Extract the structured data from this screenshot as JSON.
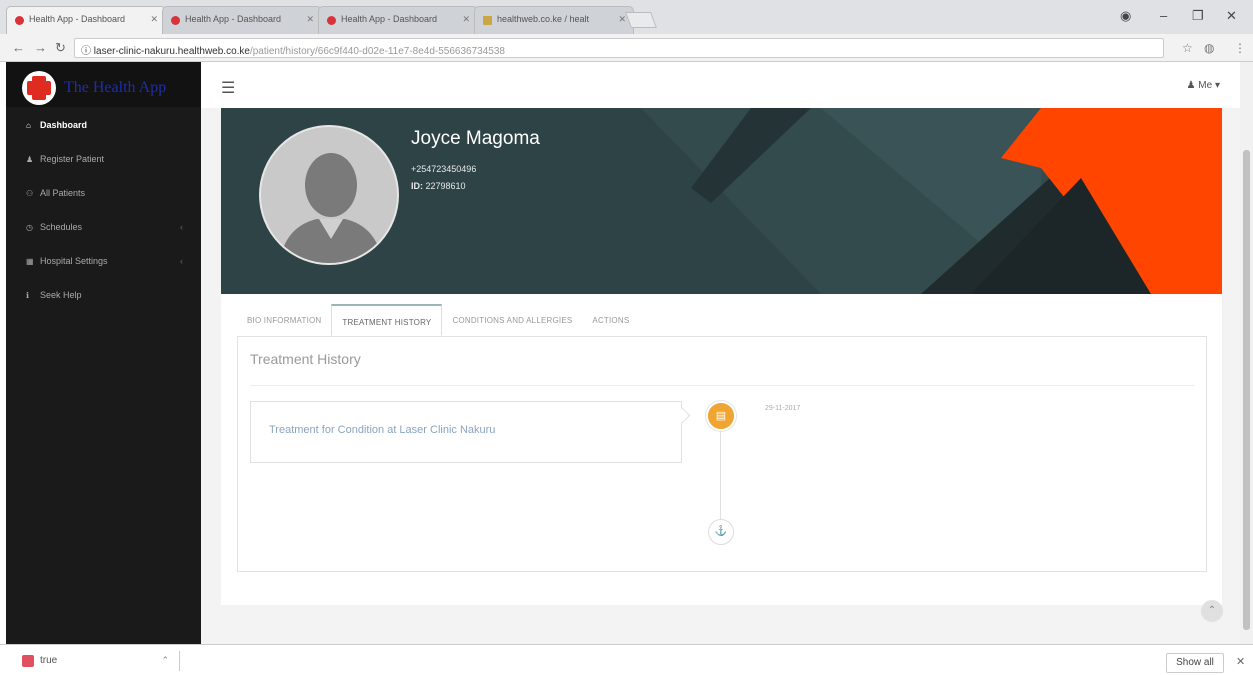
{
  "browser": {
    "tabs": [
      {
        "label": "Health App - Dashboard",
        "active": true
      },
      {
        "label": "Health App - Dashboard",
        "active": false
      },
      {
        "label": "Health App - Dashboard",
        "active": false
      },
      {
        "label": "healthweb.co.ke / healt",
        "active": false
      }
    ],
    "url_host": "laser-clinic-nakuru.healthweb.co.ke",
    "url_path": "/patient/history/66c9f440-d02e-11e7-8e4d-556636734538"
  },
  "sidebar": {
    "brand": "The Health App",
    "items": [
      {
        "label": "Dashboard",
        "icon": "home-icon",
        "active": true
      },
      {
        "label": "Register Patient",
        "icon": "user-icon"
      },
      {
        "label": "All Patients",
        "icon": "users-icon"
      },
      {
        "label": "Schedules",
        "icon": "clock-icon",
        "submenu": true
      },
      {
        "label": "Hospital Settings",
        "icon": "hospital-icon",
        "submenu": true
      },
      {
        "label": "Seek Help",
        "icon": "info-icon"
      }
    ]
  },
  "header": {
    "user_menu": "Me"
  },
  "patient": {
    "name": "Joyce Magoma",
    "phone": "+254723450496",
    "id_label": "ID:",
    "id_value": "22798610"
  },
  "profile_tabs": [
    {
      "label": "BIO INFORMATION"
    },
    {
      "label": "TREATMENT HISTORY",
      "active": true
    },
    {
      "label": "CONDITIONS AND ALLERGIES"
    },
    {
      "label": "ACTIONS"
    }
  ],
  "treatment_history": {
    "title": "Treatment History",
    "entries": [
      {
        "title": "Treatment for Condition at Laser Clinic Nakuru",
        "date": "29-11-2017"
      }
    ]
  },
  "downloads": {
    "file": "true",
    "show_all": "Show all"
  },
  "colors": {
    "banner_bg": "#2e4346",
    "banner_accent": "#ff4500",
    "timeline_dot": "#f0a432",
    "sidebar_bg": "#1a1a1a",
    "brand_text": "#1f2ea8"
  }
}
